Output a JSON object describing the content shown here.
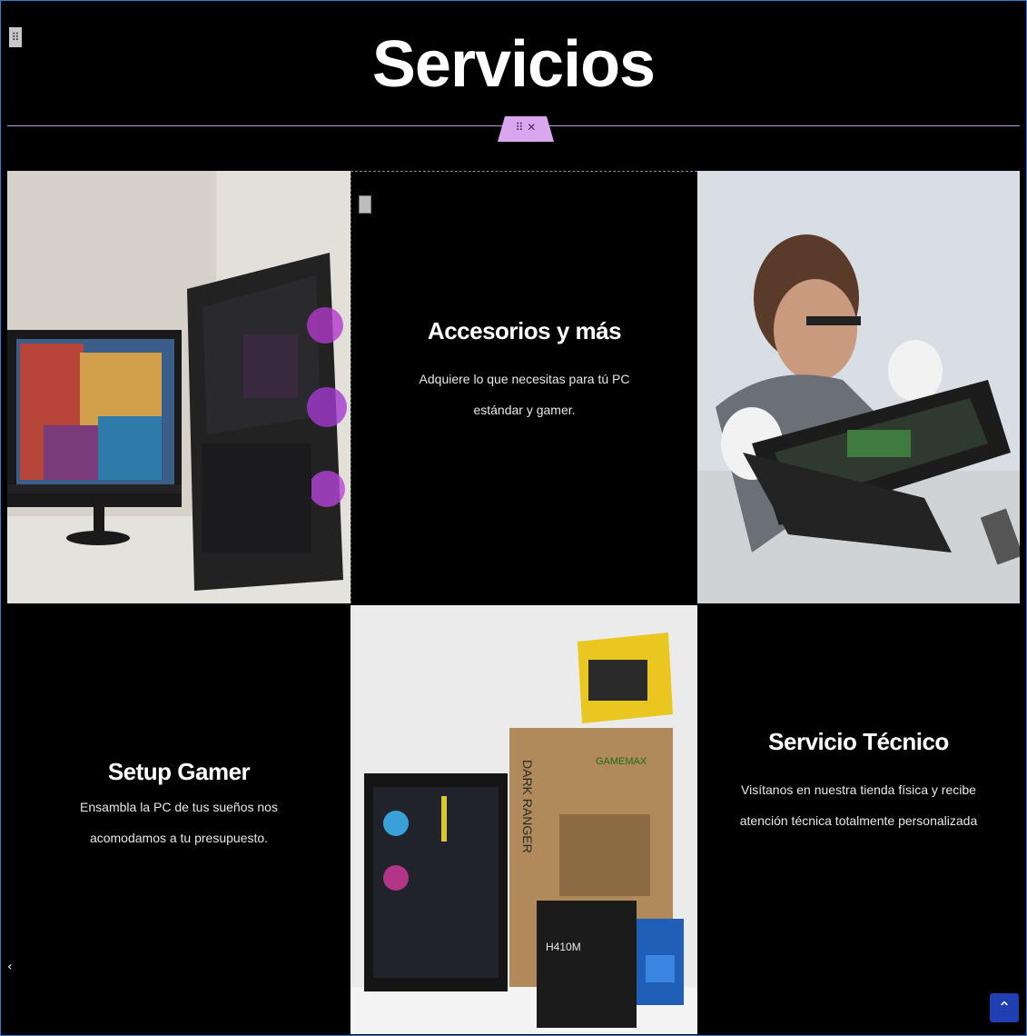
{
  "page": {
    "title": "Servicios"
  },
  "editor": {
    "handle_label": "⠿",
    "section_tab_label": "⠿  ✕"
  },
  "cards": [
    {
      "title": "Accesorios y más",
      "description": "Adquiere lo que necesitas para tú PC estándar y gamer."
    },
    {
      "title": "Setup Gamer",
      "description": "Ensambla la PC de tus sueños nos acomodamos a tu presupuesto."
    },
    {
      "title": "Servicio Técnico",
      "description": "Visítanos en nuestra tienda física y recibe atención técnica totalmente personalizada"
    }
  ],
  "product_box": {
    "brand": "GAMEMAX",
    "model": "DARK RANGER",
    "board": "H410M"
  },
  "controls": {
    "scroll_top_icon": "chevron-up-icon",
    "scroll_top_glyph": "⌃"
  },
  "colors": {
    "background": "#000000",
    "accent": "#d9a6f0",
    "scroll_button": "#1f3fb3"
  }
}
